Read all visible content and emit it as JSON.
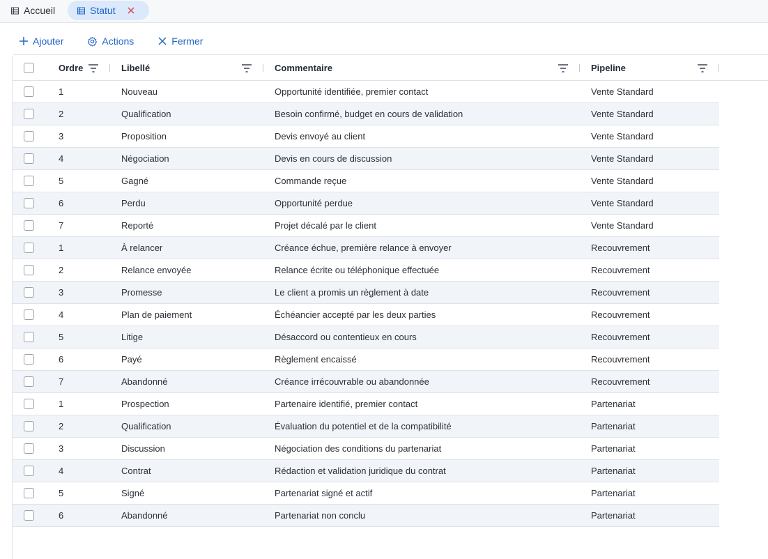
{
  "tabs": [
    {
      "label": "Accueil",
      "icon": "table-icon",
      "active": false
    },
    {
      "label": "Statut",
      "icon": "table-icon",
      "active": true
    }
  ],
  "toolbar": {
    "add_label": "Ajouter",
    "actions_label": "Actions",
    "close_label": "Fermer"
  },
  "columns": {
    "ordre": "Ordre",
    "libelle": "Libellé",
    "commentaire": "Commentaire",
    "pipeline": "Pipeline"
  },
  "rows": [
    {
      "ordre": "1",
      "libelle": "Nouveau",
      "commentaire": "Opportunité identifiée, premier contact",
      "pipeline": "Vente Standard"
    },
    {
      "ordre": "2",
      "libelle": "Qualification",
      "commentaire": "Besoin confirmé, budget en cours de validation",
      "pipeline": "Vente Standard"
    },
    {
      "ordre": "3",
      "libelle": "Proposition",
      "commentaire": "Devis envoyé au client",
      "pipeline": "Vente Standard"
    },
    {
      "ordre": "4",
      "libelle": "Négociation",
      "commentaire": "Devis en cours de discussion",
      "pipeline": "Vente Standard"
    },
    {
      "ordre": "5",
      "libelle": "Gagné",
      "commentaire": "Commande reçue",
      "pipeline": "Vente Standard"
    },
    {
      "ordre": "6",
      "libelle": "Perdu",
      "commentaire": "Opportunité perdue",
      "pipeline": "Vente Standard"
    },
    {
      "ordre": "7",
      "libelle": "Reporté",
      "commentaire": "Projet décalé par le client",
      "pipeline": "Vente Standard"
    },
    {
      "ordre": "1",
      "libelle": "À relancer",
      "commentaire": "Créance échue, première relance à envoyer",
      "pipeline": "Recouvrement"
    },
    {
      "ordre": "2",
      "libelle": "Relance envoyée",
      "commentaire": "Relance écrite ou téléphonique effectuée",
      "pipeline": "Recouvrement"
    },
    {
      "ordre": "3",
      "libelle": "Promesse",
      "commentaire": "Le client a promis un règlement à date",
      "pipeline": "Recouvrement"
    },
    {
      "ordre": "4",
      "libelle": "Plan de paiement",
      "commentaire": "Échéancier accepté par les deux parties",
      "pipeline": "Recouvrement"
    },
    {
      "ordre": "5",
      "libelle": "Litige",
      "commentaire": "Désaccord ou contentieux en cours",
      "pipeline": "Recouvrement"
    },
    {
      "ordre": "6",
      "libelle": "Payé",
      "commentaire": "Règlement encaissé",
      "pipeline": "Recouvrement"
    },
    {
      "ordre": "7",
      "libelle": "Abandonné",
      "commentaire": "Créance irrécouvrable ou abandonnée",
      "pipeline": "Recouvrement"
    },
    {
      "ordre": "1",
      "libelle": "Prospection",
      "commentaire": "Partenaire identifié, premier contact",
      "pipeline": "Partenariat"
    },
    {
      "ordre": "2",
      "libelle": "Qualification",
      "commentaire": "Évaluation du potentiel et de la compatibilité",
      "pipeline": "Partenariat"
    },
    {
      "ordre": "3",
      "libelle": "Discussion",
      "commentaire": "Négociation des conditions du partenariat",
      "pipeline": "Partenariat"
    },
    {
      "ordre": "4",
      "libelle": "Contrat",
      "commentaire": "Rédaction et validation juridique du contrat",
      "pipeline": "Partenariat"
    },
    {
      "ordre": "5",
      "libelle": "Signé",
      "commentaire": "Partenariat signé et actif",
      "pipeline": "Partenariat"
    },
    {
      "ordre": "6",
      "libelle": "Abandonné",
      "commentaire": "Partenariat non conclu",
      "pipeline": "Partenariat"
    }
  ],
  "colors": {
    "accent": "#2266c4",
    "active_tab_bg": "#dbe9fb",
    "close_red": "#d9434f",
    "row_alt": "#f1f4f9",
    "border": "#dfe2e7"
  }
}
